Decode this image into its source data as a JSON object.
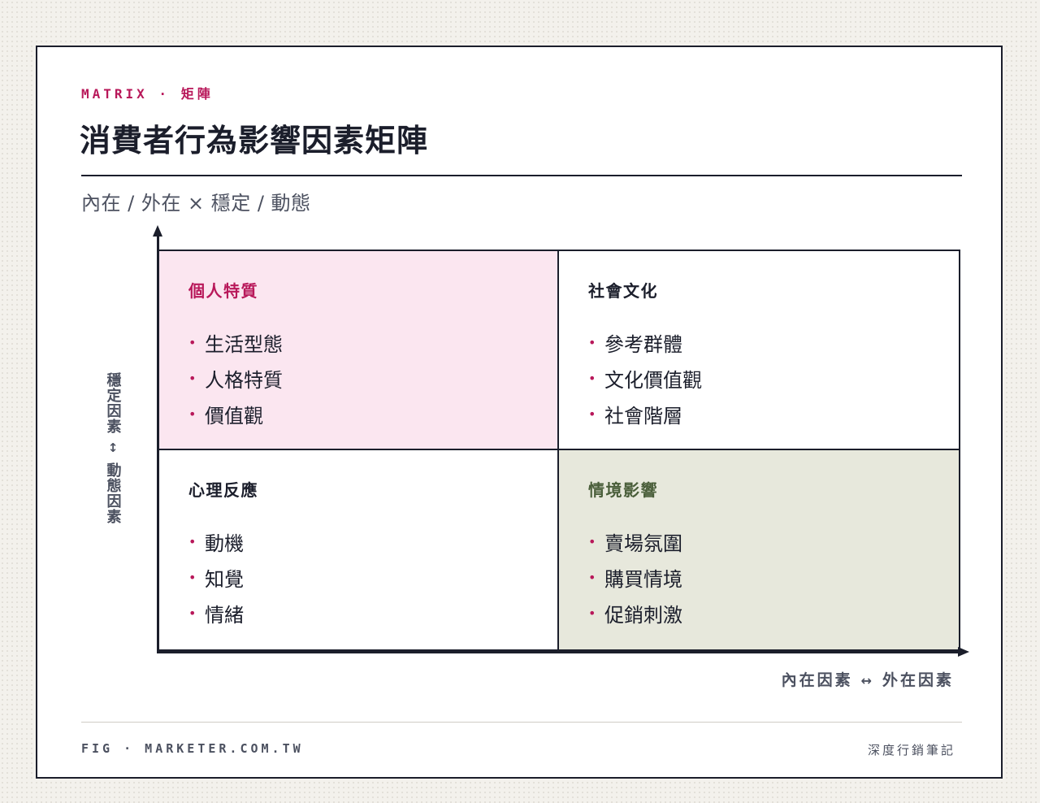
{
  "header": {
    "kicker": "MATRIX · 矩陣",
    "title": "消費者行為影響因素矩陣",
    "subtitle": "內在 / 外在 × 穩定 / 動態"
  },
  "axes": {
    "y_top": "穩定因素",
    "y_arrow": "↕",
    "y_bottom": "動態因素",
    "x_left": "內在因素",
    "x_arrow": "↔",
    "x_right": "外在因素"
  },
  "quadrants": [
    {
      "title": "個人特質",
      "items": [
        "生活型態",
        "人格特質",
        "價值觀"
      ],
      "color": "#b8185a",
      "background": "#fbe6f0"
    },
    {
      "title": "社會文化",
      "items": [
        "參考群體",
        "文化價值觀",
        "社會階層"
      ],
      "color": "#1b1e2b",
      "background": "#ffffff"
    },
    {
      "title": "心理反應",
      "items": [
        "動機",
        "知覺",
        "情緒"
      ],
      "color": "#1b1e2b",
      "background": "#ffffff"
    },
    {
      "title": "情境影響",
      "items": [
        "賣場氛圍",
        "購買情境",
        "促銷刺激"
      ],
      "color": "#4a5e3a",
      "background": "#e7e8dc"
    }
  ],
  "bullet": "•",
  "footer": {
    "left": "FIG · MARKETER.COM.TW",
    "right": "深度行銷筆記"
  }
}
